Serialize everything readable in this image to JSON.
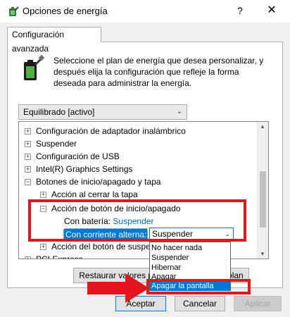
{
  "window": {
    "title": "Opciones de energía",
    "help_glyph": "?",
    "close_glyph": "✕",
    "icon": "power-options-icon"
  },
  "tab": {
    "label": "Configuración avanzada"
  },
  "intro": {
    "icon": "battery-plug-icon",
    "text": "Seleccione el plan de energía que desea personalizar, y después elija la configuración que refleje la forma deseada para administrar la energía."
  },
  "plan_select": {
    "value": "Equilibrado [activo]"
  },
  "tree": {
    "items": [
      {
        "label": "Configuración de adaptador inalámbrico",
        "expander": "+"
      },
      {
        "label": "Suspender",
        "expander": "+"
      },
      {
        "label": "Configuración de USB",
        "expander": "+"
      },
      {
        "label": "Intel(R) Graphics Settings",
        "expander": "+"
      },
      {
        "label": "Botones de inicio/apagado y tapa",
        "expander": "−"
      },
      {
        "label": "Acción al cerrar la tapa",
        "expander": "+"
      },
      {
        "label": "Acción de botón de inicio/apagado",
        "expander": "−"
      },
      {
        "label": "Acción del botón de suspe",
        "expander": "+"
      },
      {
        "label": "PCI Express",
        "expander": "+"
      }
    ],
    "battery": {
      "label": "Con batería:",
      "value": "Suspender"
    },
    "ac": {
      "label": "Con corriente alterna:",
      "value": "Suspender"
    }
  },
  "dropdown": {
    "options": [
      "No hacer nada",
      "Suspender",
      "Hibernar",
      "Apagar",
      "Apagar la pantalla"
    ],
    "selected_index": 4
  },
  "restore_button": {
    "label": "Restaurar valores predeterminados del plan"
  },
  "buttons": {
    "accept": "Aceptar",
    "cancel": "Cancelar",
    "apply": "Aplicar"
  },
  "colors": {
    "highlight": "#0078d7",
    "annotation": "#e2161c",
    "link": "#0066cc"
  }
}
